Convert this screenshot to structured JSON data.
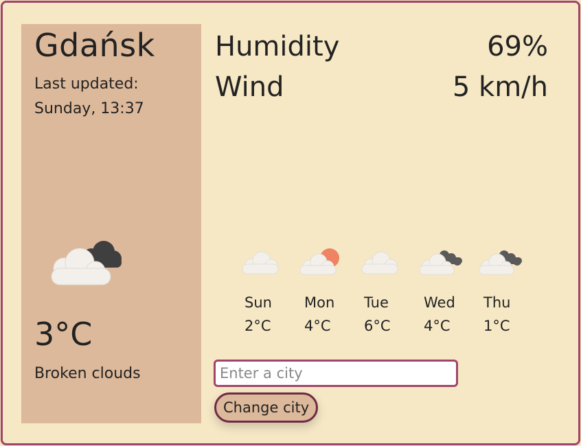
{
  "current": {
    "city": "Gdańsk",
    "updated_label": "Last updated:",
    "updated_time": "Sunday, 13:37",
    "temperature": "3°C",
    "description": "Broken clouds",
    "icon": "broken-clouds-icon"
  },
  "stats": {
    "humidity_label": "Humidity",
    "humidity_value": "69%",
    "wind_label": "Wind",
    "wind_value": "5 km/h"
  },
  "forecast": [
    {
      "day": "Sun",
      "temp": "2°C",
      "icon": "cloud-icon"
    },
    {
      "day": "Mon",
      "temp": "4°C",
      "icon": "sun-behind-cloud-icon"
    },
    {
      "day": "Tue",
      "temp": "6°C",
      "icon": "cloud-icon"
    },
    {
      "day": "Wed",
      "temp": "4°C",
      "icon": "broken-clouds-icon"
    },
    {
      "day": "Thu",
      "temp": "1°C",
      "icon": "broken-clouds-icon"
    }
  ],
  "search": {
    "placeholder": "Enter a city",
    "button_label": "Change city"
  },
  "colors": {
    "background": "#f6e8c5",
    "panel": "#ddb99b",
    "accent": "#a0456a",
    "sun": "#ee8463",
    "dark_cloud": "#444444",
    "light_cloud": "#f3f0ec"
  }
}
